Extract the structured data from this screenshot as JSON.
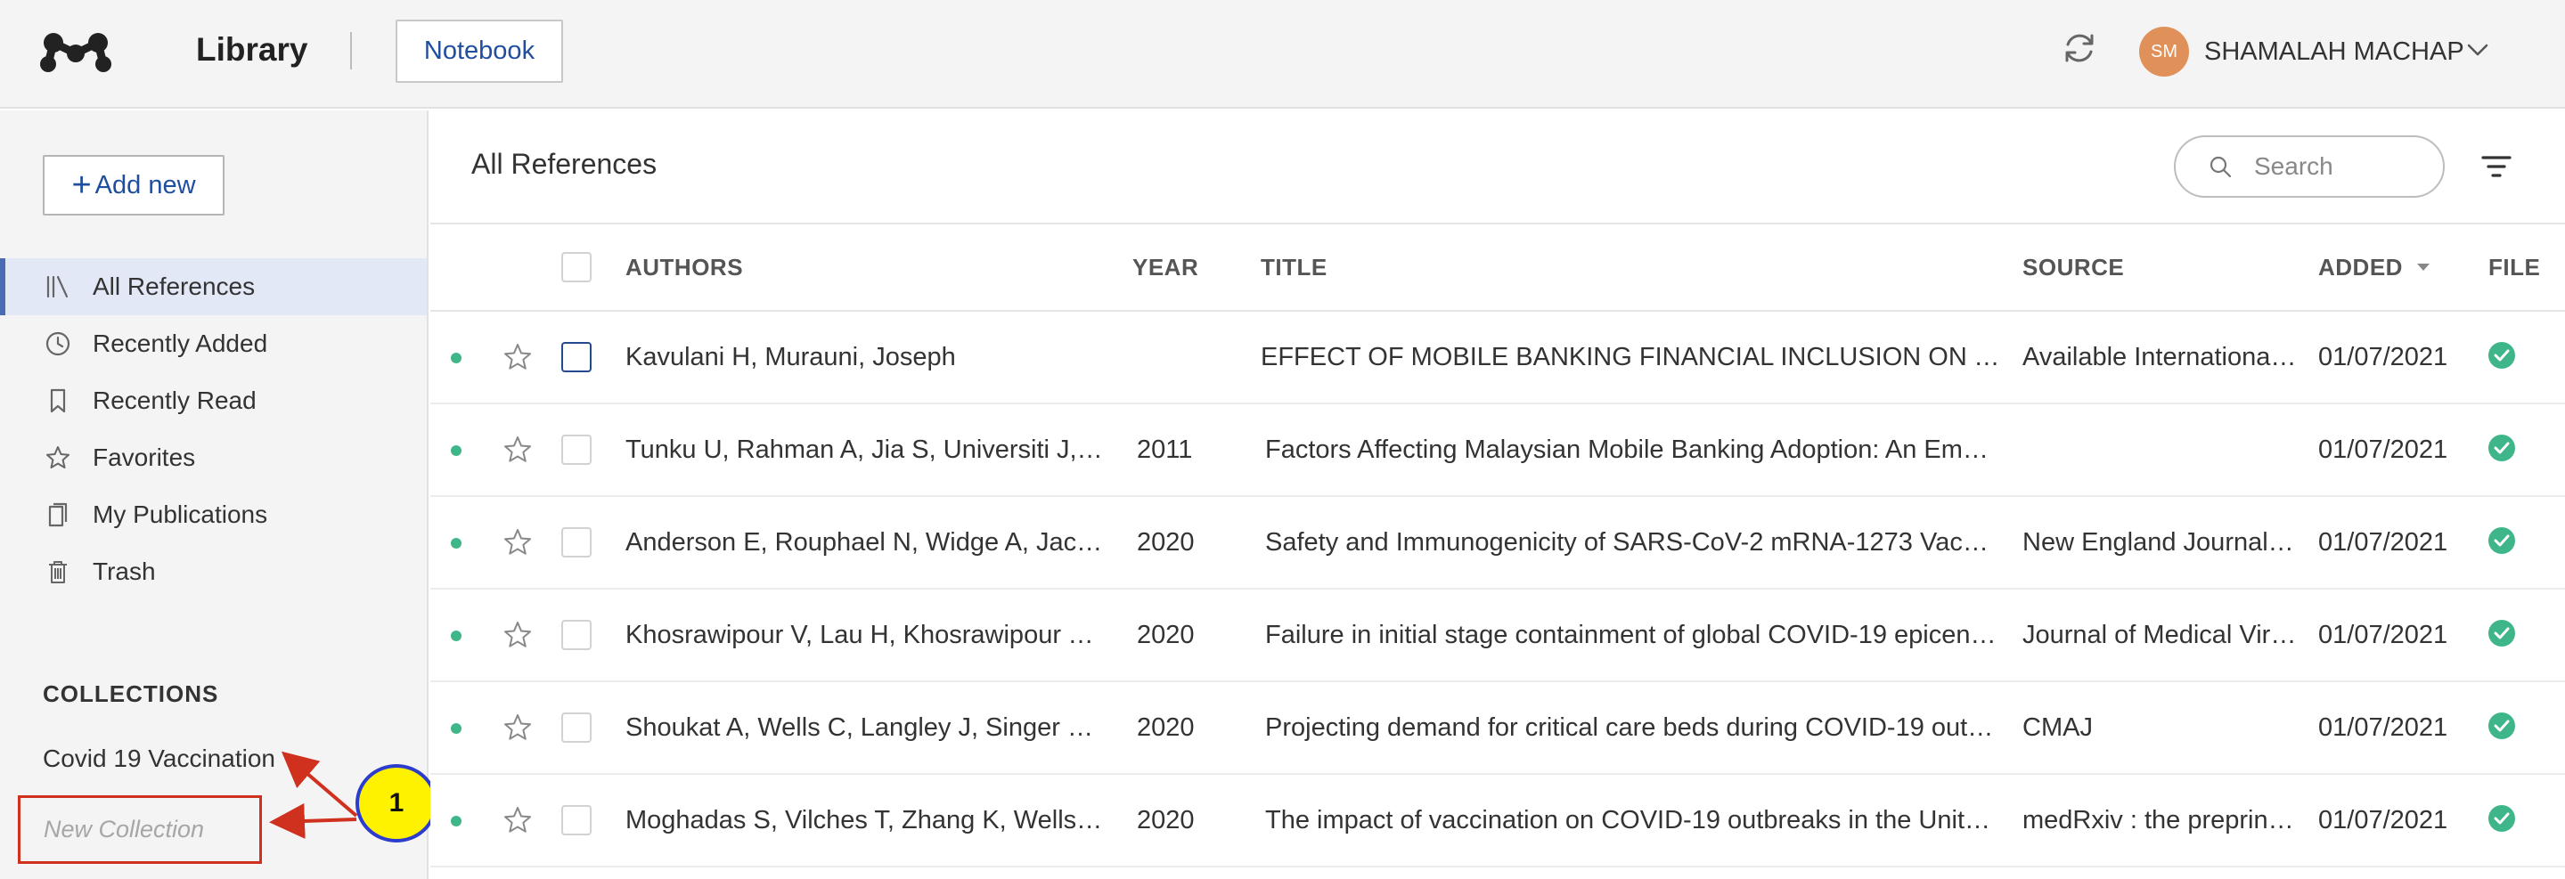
{
  "header": {
    "app_title": "Library",
    "notebook_label": "Notebook",
    "user": {
      "initials": "SM",
      "name": "SHAMALAH MACHAP"
    }
  },
  "sidebar": {
    "add_new_label": "Add new",
    "items": [
      {
        "label": "All References",
        "icon": "library-icon",
        "active": true
      },
      {
        "label": "Recently Added",
        "icon": "clock-icon"
      },
      {
        "label": "Recently Read",
        "icon": "bookmark-icon"
      },
      {
        "label": "Favorites",
        "icon": "star-icon"
      },
      {
        "label": "My Publications",
        "icon": "publications-icon"
      },
      {
        "label": "Trash",
        "icon": "trash-icon"
      }
    ],
    "collections_title": "COLLECTIONS",
    "collections": [
      "Covid 19 Vaccination"
    ],
    "new_collection_placeholder": "New Collection"
  },
  "annotation": {
    "callout_number": "1",
    "color": "#d0301e"
  },
  "main": {
    "title": "All References",
    "search_placeholder": "Search",
    "columns": {
      "authors": "AUTHORS",
      "year": "YEAR",
      "title": "TITLE",
      "source": "SOURCE",
      "added": "ADDED",
      "file": "FILE"
    },
    "rows": [
      {
        "authors": "Kavulani H, Murauni, Joseph",
        "year": "",
        "title": "EFFECT OF MOBILE BANKING FINANCIAL INCLUSION ON T…",
        "source": "Available Internationa…",
        "added": "01/07/2021"
      },
      {
        "authors": "Tunku U, Rahman A, Jia S, Universiti J, …",
        "year": "2011",
        "title": "Factors Affecting Malaysian Mobile Banking Adoption: An Empir…",
        "source": "",
        "added": "01/07/2021"
      },
      {
        "authors": "Anderson E, Rouphael N, Widge A, Jack…",
        "year": "2020",
        "title": "Safety and Immunogenicity of SARS-CoV-2 mRNA-1273 Vaccin…",
        "source": "New England Journal…",
        "added": "01/07/2021"
      },
      {
        "authors": "Khosrawipour V, Lau H, Khosrawipour T,…",
        "year": "2020",
        "title": "Failure in initial stage containment of global COVID-19 epicenters",
        "source": "Journal of Medical Vir…",
        "added": "01/07/2021"
      },
      {
        "authors": "Shoukat A, Wells C, Langley J, Singer B,…",
        "year": "2020",
        "title": "Projecting demand for critical care beds during COVID-19 outbr…",
        "source": "CMAJ",
        "added": "01/07/2021"
      },
      {
        "authors": "Moghadas S, Vilches T, Zhang K, Wells …",
        "year": "2020",
        "title": "The impact of vaccination on COVID-19 outbreaks in the United…",
        "source": "medRxiv : the preprin…",
        "added": "01/07/2021"
      }
    ]
  }
}
